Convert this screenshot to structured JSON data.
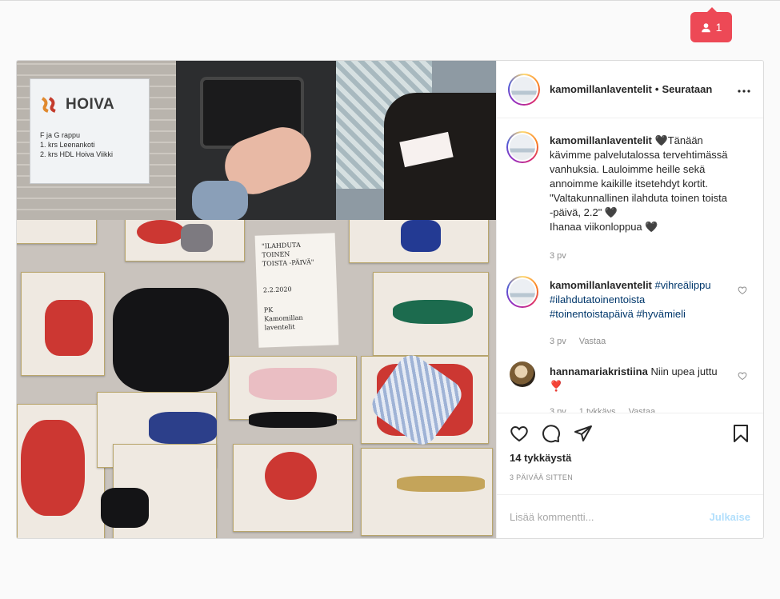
{
  "notification": {
    "icon": "person-icon",
    "count": "1",
    "color": "#ed4956"
  },
  "media": {
    "sign": {
      "brand": "HOIVA",
      "line1": "F ja G rappu",
      "line2": "1. krs Leenankoti",
      "line3": "2. krs HDL Hoiva Viikki"
    },
    "note": {
      "line1": "\"ILAHDUTA",
      "line2": "TOINEN",
      "line3": "TOISTA -PÄIVÄ\"",
      "line4": "2.2.2020",
      "line5": "PK",
      "line6": "Kamomillan",
      "line7": "laventelit"
    }
  },
  "header": {
    "username": "kamomillanlaventelit",
    "separator": "•",
    "follow_label": "Seurataan",
    "more_icon": "more-dots-icon"
  },
  "comments": [
    {
      "username": "kamomillanlaventelit",
      "text": " 🖤Tänään kävimme palvelutalossa tervehtimässä vanhuksia. Lauloimme heille sekä annoimme kaikille itsetehdyt kortit. \"Valtakunnallinen ilahduta toinen toista -päivä, 2.2\" 🖤",
      "text2": "Ihanaa viikonloppua 🖤",
      "time": "3 pv"
    },
    {
      "username": "kamomillanlaventelit",
      "tags": [
        "#vihreälippu",
        "#ilahdutatoinentoista",
        "#toinentoistapäivä",
        "#hyvämieli"
      ],
      "time": "3 pv",
      "reply": "Vastaa"
    },
    {
      "username": "hannamariakristiina",
      "text": " Niin upea juttu ❣️",
      "time": "3 pv",
      "likes": "1 tykkäys",
      "reply": "Vastaa"
    }
  ],
  "actions": {
    "likes_text": "14 tykkäystä",
    "date_text": "3 PÄIVÄÄ SITTEN"
  },
  "add_comment": {
    "placeholder": "Lisää kommentti...",
    "publish_label": "Julkaise",
    "publish_color": "#b2dffc"
  }
}
